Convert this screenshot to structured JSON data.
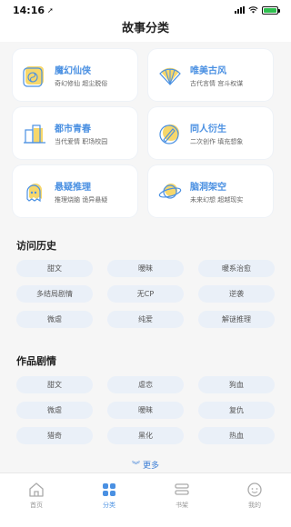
{
  "status": {
    "time": "14:16"
  },
  "header": {
    "title": "故事分类"
  },
  "categories": [
    {
      "title": "魔幻仙侠",
      "subtitle": "奇幻修仙 超尘脱俗",
      "icon": "yin-yang-icon"
    },
    {
      "title": "唯美古风",
      "subtitle": "古代言情 宫斗权谋",
      "icon": "fan-icon"
    },
    {
      "title": "都市青春",
      "subtitle": "当代爱情 职场校园",
      "icon": "city-buildings-icon"
    },
    {
      "title": "同人衍生",
      "subtitle": "二次创作 填充想象",
      "icon": "pen-circle-icon"
    },
    {
      "title": "悬疑推理",
      "subtitle": "推理烧脑 诡异悬疑",
      "icon": "ghost-icon"
    },
    {
      "title": "脑洞架空",
      "subtitle": "未来幻想 超越现实",
      "icon": "planet-icon"
    }
  ],
  "history": {
    "title": "访问历史",
    "tags": [
      "甜文",
      "暧昧",
      "暖系治愈",
      "多结局剧情",
      "无CP",
      "逆袭",
      "微虐",
      "纯爱",
      "解谜推理"
    ]
  },
  "plots": {
    "title": "作品剧情",
    "tags": [
      "甜文",
      "虐恋",
      "狗血",
      "微虐",
      "暧昧",
      "复仇",
      "猎奇",
      "黑化",
      "热血"
    ]
  },
  "more_label": "更多",
  "tabs": [
    {
      "label": "首页",
      "icon": "home-icon"
    },
    {
      "label": "分类",
      "icon": "category-icon"
    },
    {
      "label": "书架",
      "icon": "bookshelf-icon"
    },
    {
      "label": "我的",
      "icon": "profile-icon"
    }
  ],
  "colors": {
    "accent": "#4a90e2",
    "tag_bg": "#eaf0f8",
    "icon_yellow": "#f6d76b"
  }
}
